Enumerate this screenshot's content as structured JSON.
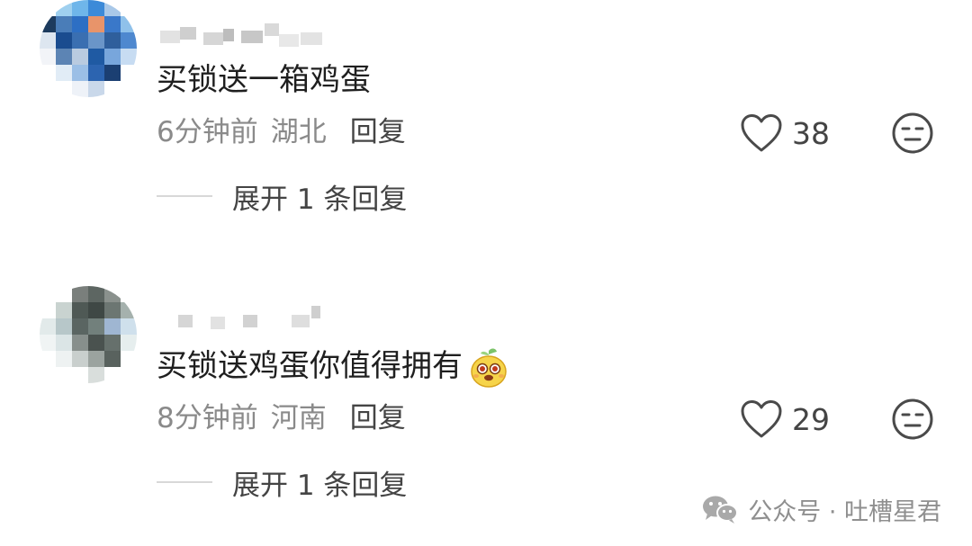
{
  "comments": [
    {
      "text": "买锁送一箱鸡蛋",
      "time": "6分钟前",
      "location": "湖北",
      "reply_label": "回复",
      "likes": "38",
      "expand_label": "展开 1 条回复",
      "username_censored": true,
      "avatar_censored": true
    },
    {
      "text": "买锁送鸡蛋你值得拥有",
      "emoji": "cute-face-emoji",
      "time": "8分钟前",
      "location": "河南",
      "reply_label": "回复",
      "likes": "29",
      "expand_label": "展开 1 条回复",
      "username_censored": true,
      "avatar_censored": true
    }
  ],
  "icons": {
    "like": "heart-outline-icon",
    "dislike": "neutral-face-icon",
    "watermark": "wechat-icon"
  },
  "watermark": {
    "text": "公众号 · 吐槽星君"
  },
  "colors": {
    "text": "#1f1f1f",
    "meta": "#8a8a8a",
    "action": "#444444",
    "divider": "#d8d8d8"
  }
}
